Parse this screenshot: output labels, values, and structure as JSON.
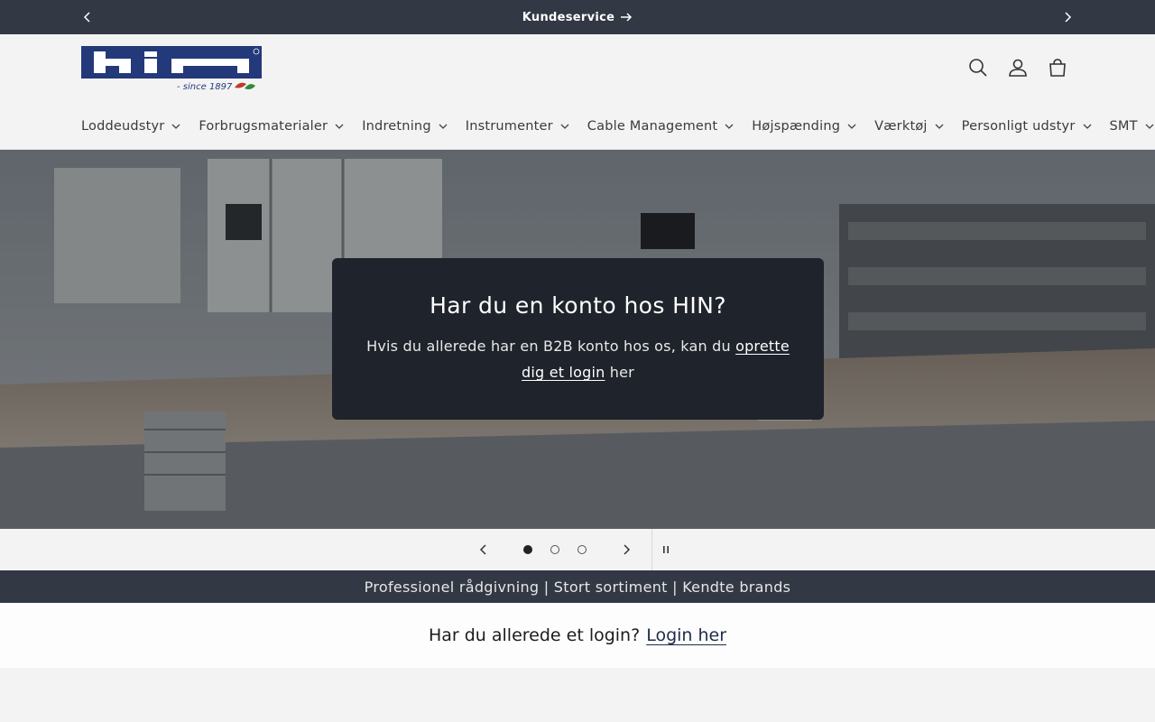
{
  "announcement": {
    "text": "Kundeservice",
    "prev_icon": "chevron-left-icon",
    "next_icon": "chevron-right-icon",
    "arrow_icon": "arrow-right-icon"
  },
  "header": {
    "logo_text": "hin",
    "logo_tagline": "- since 1897",
    "icons": [
      "search-icon",
      "account-icon",
      "cart-icon"
    ],
    "nav": [
      {
        "label": "Loddeudstyr"
      },
      {
        "label": "Forbrugsmaterialer"
      },
      {
        "label": "Indretning"
      },
      {
        "label": "Instrumenter"
      },
      {
        "label": "Cable Management"
      },
      {
        "label": "Højspænding"
      },
      {
        "label": "Værktøj"
      },
      {
        "label": "Personligt udstyr"
      },
      {
        "label": "SMT"
      }
    ]
  },
  "hero": {
    "title": "Har du en konto hos HIN?",
    "text_before": "Hvis du allerede har en B2B konto hos os, kan du ",
    "link": "oprette dig et login",
    "text_after": " her"
  },
  "slider": {
    "slides": 3,
    "active": 1,
    "pause_icon": "pause-icon"
  },
  "usp": {
    "text": "Professionel rådgivning | Stort sortiment | Kendte brands"
  },
  "login_strip": {
    "question": "Har du allerede et login?",
    "link": "Login her"
  },
  "colors": {
    "dark_bar": "#323844",
    "card_bg": "#1f232b",
    "logo_blue": "#24397a",
    "page_bg": "#f3f3f3"
  }
}
